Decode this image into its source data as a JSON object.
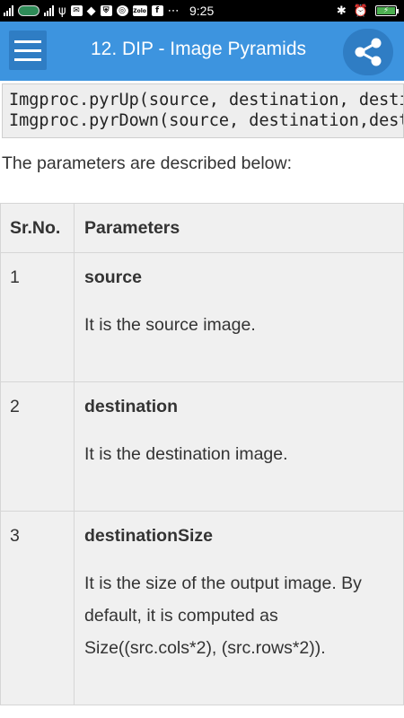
{
  "status_bar": {
    "time": "9:25",
    "icons": [
      "signal-icon",
      "carrier-icon",
      "signal-icon",
      "usb-icon",
      "mail-icon",
      "vpn-icon",
      "shield-icon",
      "chrome-icon",
      "zolo-icon",
      "facebook-icon",
      "dots-icon",
      "bluetooth-icon",
      "alarm-icon",
      "battery-charging-icon"
    ],
    "zolo_label": "Zolo"
  },
  "app_bar": {
    "title": "12. DIP - Image Pyramids",
    "menu_icon": "hamburger-menu-icon",
    "share_icon": "share-icon",
    "color": "#3d94df"
  },
  "code": {
    "lines": [
      "Imgproc.pyrUp(source, destination, destinationSize);",
      "Imgproc.pyrDown(source, destination,destinationSize);"
    ]
  },
  "intro": "The parameters are described below:",
  "table": {
    "headers": [
      "Sr.No.",
      "Parameters"
    ],
    "rows": [
      {
        "no": "1",
        "name": "source",
        "description": "It is the source image."
      },
      {
        "no": "2",
        "name": "destination",
        "description": "It is the destination image."
      },
      {
        "no": "3",
        "name": "destinationSize",
        "description": "It is the size of the output image. By default, it is computed as Size((src.cols*2), (src.rows*2))."
      }
    ]
  }
}
